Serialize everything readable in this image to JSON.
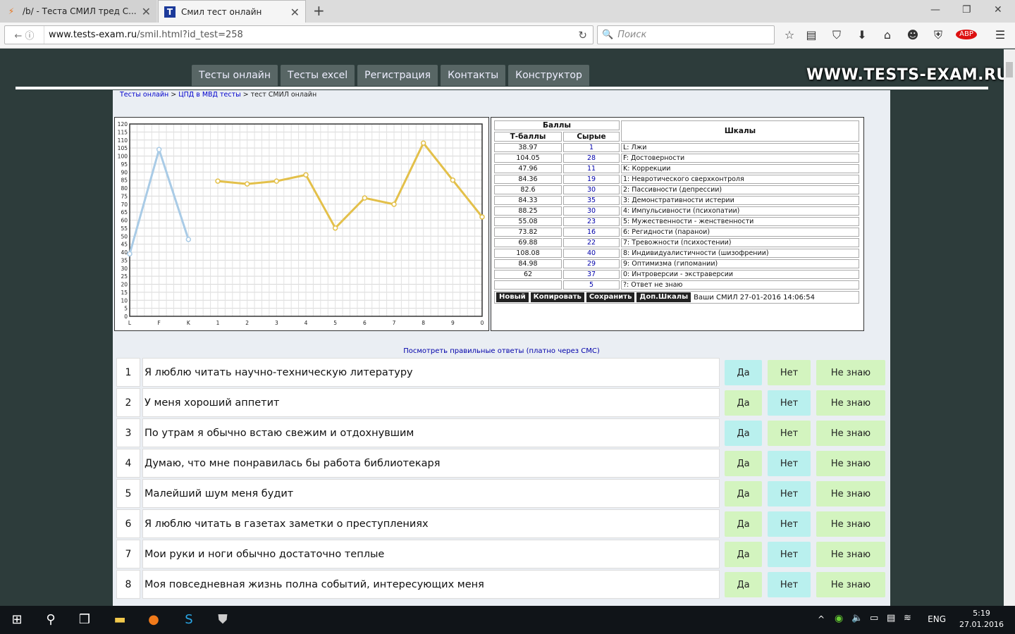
{
  "browser": {
    "tabs": [
      {
        "title": "/b/ - Теста СМИЛ тред С...",
        "active": false
      },
      {
        "title": "Смил тест онлайн",
        "active": true
      }
    ],
    "url_domain": "www.tests-exam.ru",
    "url_path": "/smil.html?id_test=258",
    "search_placeholder": "Поиск"
  },
  "site": {
    "logo": "WWW.TESTS-EXAM.RU",
    "menu": [
      "Тесты онлайн",
      "Тесты excel",
      "Регистрация",
      "Контакты",
      "Конструктор"
    ],
    "breadcrumb": {
      "link1": "Тесты онлайн",
      "link2": "ЦПД в МВД тесты",
      "current": "тест СМИЛ онлайн",
      "sep": " > "
    }
  },
  "chart_data": {
    "type": "line",
    "categories": [
      "L",
      "F",
      "K",
      "1",
      "2",
      "3",
      "4",
      "5",
      "6",
      "7",
      "8",
      "9",
      "0"
    ],
    "ylim": [
      0,
      120
    ],
    "yticks": [
      0,
      5,
      10,
      15,
      20,
      25,
      30,
      35,
      40,
      45,
      50,
      55,
      60,
      65,
      70,
      75,
      80,
      85,
      90,
      95,
      100,
      105,
      110,
      115,
      120
    ],
    "grid": true,
    "series": [
      {
        "color": "#a9cbe6",
        "x": [
          "L",
          "F",
          "K"
        ],
        "values": [
          38.97,
          104.05,
          47.96
        ]
      },
      {
        "color": "#e3c04a",
        "x": [
          "1",
          "2",
          "3",
          "4",
          "5",
          "6",
          "7",
          "8",
          "9",
          "0"
        ],
        "values": [
          84.36,
          82.6,
          84.33,
          88.25,
          55.08,
          73.82,
          69.88,
          108.08,
          84.98,
          62
        ]
      }
    ]
  },
  "scores": {
    "header_group": "Баллы",
    "header_t": "Т-баллы",
    "header_raw": "Сырые",
    "header_scales": "Шкалы",
    "rows": [
      {
        "t": "38.97",
        "raw": "1",
        "scale": "L: Лжи"
      },
      {
        "t": "104.05",
        "raw": "28",
        "scale": "F: Достоверности"
      },
      {
        "t": "47.96",
        "raw": "11",
        "scale": "K: Коррекции"
      },
      {
        "t": "84.36",
        "raw": "19",
        "scale": "1: Невротического сверхконтроля"
      },
      {
        "t": "82.6",
        "raw": "30",
        "scale": "2: Пассивности (депрессии)"
      },
      {
        "t": "84.33",
        "raw": "35",
        "scale": "3: Демонстративности истерии"
      },
      {
        "t": "88.25",
        "raw": "30",
        "scale": "4: Импульсивности (психопатии)"
      },
      {
        "t": "55.08",
        "raw": "23",
        "scale": "5: Мужественности - женственности"
      },
      {
        "t": "73.82",
        "raw": "16",
        "scale": "6: Регидности (паранои)"
      },
      {
        "t": "69.88",
        "raw": "22",
        "scale": "7: Тревожности (психостении)"
      },
      {
        "t": "108.08",
        "raw": "40",
        "scale": "8: Индивидуалистичности (шизофрении)"
      },
      {
        "t": "84.98",
        "raw": "29",
        "scale": "9: Оптимизма (гипомании)"
      },
      {
        "t": "62",
        "raw": "37",
        "scale": "0: Интроверсии - экстраверсии"
      },
      {
        "t": "",
        "raw": "5",
        "scale": "?: Ответ не знаю"
      }
    ],
    "buttons": [
      "Новый",
      "Копировать",
      "Сохранить",
      "Доп.Шкалы"
    ],
    "saved_text": "Ваши СМИЛ 27-01-2016 14:06:54"
  },
  "answers_link": "Посмотреть правильные ответы (платно через СМС)",
  "answer_labels": {
    "yes": "Да",
    "no": "Нет",
    "dk": "Не знаю"
  },
  "questions": [
    {
      "n": "1",
      "text": "Я люблю читать научно-техническую литературу",
      "selected": "yes"
    },
    {
      "n": "2",
      "text": "У меня хороший аппетит",
      "selected": "no"
    },
    {
      "n": "3",
      "text": "По утрам я обычно встаю свежим и отдохнувшим",
      "selected": "yes"
    },
    {
      "n": "4",
      "text": "Думаю, что мне понравилась бы работа библиотекаря",
      "selected": "no"
    },
    {
      "n": "5",
      "text": "Малейший шум меня будит",
      "selected": "no"
    },
    {
      "n": "6",
      "text": "Я люблю читать в газетах заметки о преступлениях",
      "selected": "no"
    },
    {
      "n": "7",
      "text": "Мои руки и ноги обычно достаточно теплые",
      "selected": "no"
    },
    {
      "n": "8",
      "text": "Моя повседневная жизнь полна событий, интересующих меня",
      "selected": "no"
    }
  ],
  "taskbar": {
    "lang": "ENG",
    "time": "5:19",
    "date": "27.01.2016"
  },
  "colors": {
    "selected": "#b9f0ee",
    "unselected": "#d3f4bf"
  }
}
